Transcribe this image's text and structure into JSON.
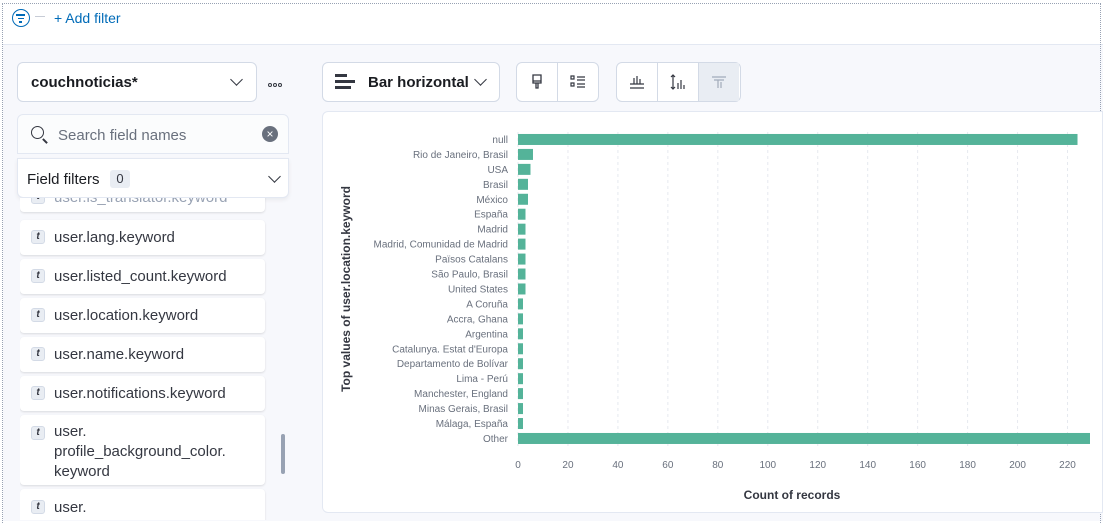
{
  "filter_bar": {
    "add_filter_label": "+ Add filter"
  },
  "sidebar": {
    "index_pattern": "couchnoticias*",
    "search_placeholder": "Search field names",
    "field_filters_label": "Field filters",
    "field_filters_count": "0",
    "fields": [
      {
        "name": "user.is_translator.keyword",
        "type_token": "t"
      },
      {
        "name": "user.lang.keyword",
        "type_token": "t"
      },
      {
        "name": "user.listed_count.keyword",
        "type_token": "t"
      },
      {
        "name": "user.location.keyword",
        "type_token": "t"
      },
      {
        "name": "user.name.keyword",
        "type_token": "t"
      },
      {
        "name": "user.notifications.keyword",
        "type_token": "t"
      },
      {
        "name": "user.\nprofile_background_color.\nkeyword",
        "type_token": "t"
      },
      {
        "name": "user.\nprofile_background_image",
        "type_token": "t"
      }
    ]
  },
  "toolbar": {
    "chart_type_label": "Bar horizontal",
    "icons": [
      "paintbrush-icon",
      "list-settings-icon",
      "x-axis-icon",
      "y-axis-icon",
      "y-axis-right-icon"
    ]
  },
  "colors": {
    "bar": "#54b399",
    "link": "#006bb8"
  },
  "chart_data": {
    "type": "bar",
    "orientation": "horizontal",
    "categories": [
      "null",
      "Rio de Janeiro, Brasil",
      "USA",
      "Brasil",
      "México",
      "España",
      "Madrid",
      "Madrid, Comunidad de Madrid",
      "Països Catalans",
      "São Paulo, Brasil",
      "United States",
      "A Coruña",
      "Accra, Ghana",
      "Argentina",
      "Catalunya. Estat d'Europa",
      "Departamento de Bolívar",
      "Lima - Perú",
      "Manchester, England",
      "Minas Gerais, Brasil",
      "Málaga, España",
      "Other"
    ],
    "values": [
      224,
      6,
      5,
      4,
      4,
      3,
      3,
      3,
      3,
      3,
      3,
      2,
      2,
      2,
      2,
      2,
      2,
      2,
      2,
      2,
      229
    ],
    "xlabel": "Count of records",
    "ylabel": "Top values of user.location.keyword",
    "xticks": [
      "0",
      "20",
      "40",
      "60",
      "80",
      "100",
      "120",
      "140",
      "160",
      "180",
      "200",
      "220"
    ],
    "xlim": [
      0,
      229
    ],
    "grid": true
  }
}
